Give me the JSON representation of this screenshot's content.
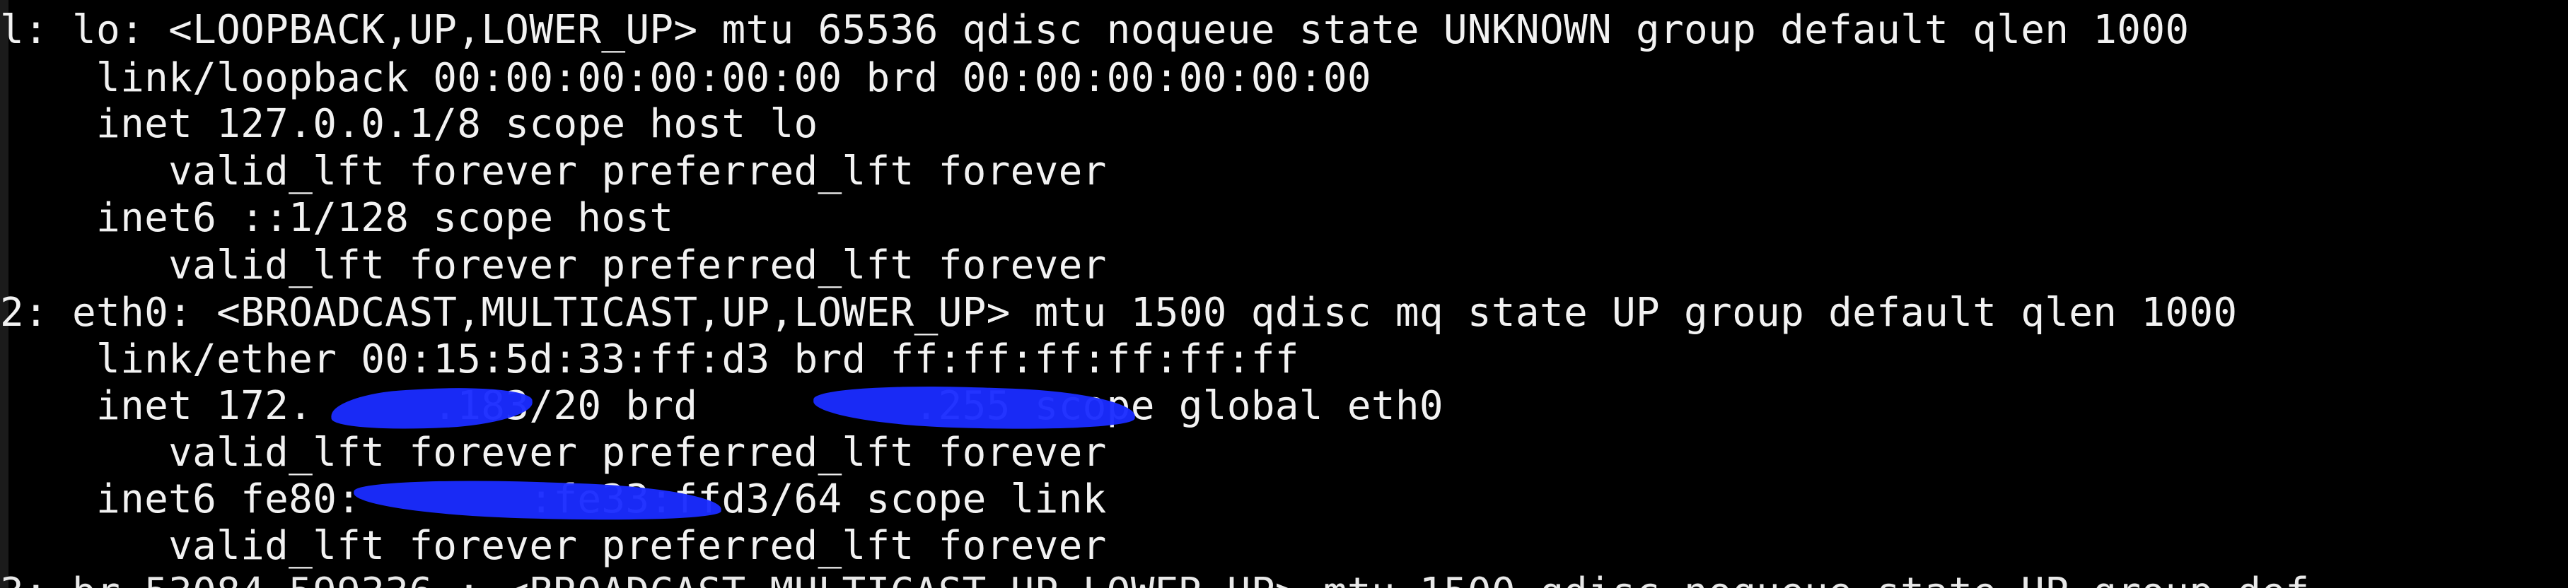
{
  "terminal": {
    "lines": [
      "l: lo: <LOOPBACK,UP,LOWER_UP> mtu 65536 qdisc noqueue state UNKNOWN group default qlen 1000",
      "    link/loopback 00:00:00:00:00:00 brd 00:00:00:00:00:00",
      "    inet 127.0.0.1/8 scope host lo",
      "       valid_lft forever preferred_lft forever",
      "    inet6 ::1/128 scope host",
      "       valid_lft forever preferred_lft forever",
      "2: eth0: <BROADCAST,MULTICAST,UP,LOWER_UP> mtu 1500 qdisc mq state UP group default qlen 1000",
      "    link/ether 00:15:5d:33:ff:d3 brd ff:ff:ff:ff:ff:ff",
      "    inet 172.     .183/20 brd         .255 scope global eth0",
      "       valid_lft forever preferred_lft forever",
      "    inet6 fe80:       :fe33:ffd3/64 scope link",
      "       valid_lft forever preferred_lft forever",
      "3: br-53084 599336 : <BROADCAST,MULTICAST,UP,LOWER_UP> mtu 1500 qdisc noqueue state UP group def"
    ]
  },
  "colors": {
    "background": "#000000",
    "text": "#f2f2f2",
    "redaction": "#1a2cff"
  }
}
